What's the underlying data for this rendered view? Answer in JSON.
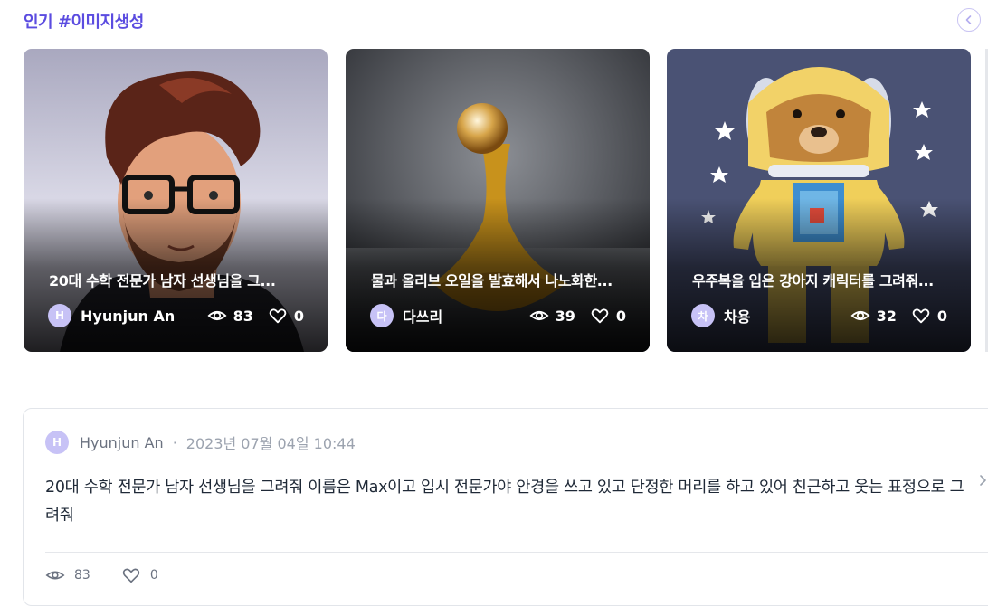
{
  "section": {
    "title": "인기 #이미지생성"
  },
  "cards": [
    {
      "title": "20대 수학 전문가 남자 선생님을 그...",
      "author": "Hyunjun An",
      "avatar_letter": "H",
      "views": "83",
      "likes": "0"
    },
    {
      "title": "물과 올리브 오일을 발효해서 나노화한...",
      "author": "다쓰리",
      "avatar_letter": "다",
      "views": "39",
      "likes": "0"
    },
    {
      "title": "우주복을 입은 강아지 캐릭터를 그려줘...",
      "author": "차용",
      "avatar_letter": "차",
      "views": "32",
      "likes": "0"
    }
  ],
  "post": {
    "author": "Hyunjun An",
    "avatar_letter": "H",
    "separator": "·",
    "date": "2023년 07월 04일 10:44",
    "body": "20대 수학 전문가 남자 선생님을 그려줘 이름은 Max이고 입시 전문가야 안경을 쓰고 있고 단정한 머리를 하고 있어 친근하고 웃는 표정으로 그려줘",
    "views": "83",
    "likes": "0"
  },
  "colors": {
    "accent": "#5b4ce0",
    "avatar_bg": "#c7c2f6"
  },
  "icons": {
    "views": "eye-icon",
    "likes": "heart-icon",
    "prev": "chevron-left-icon",
    "more": "chevron-right-icon"
  }
}
